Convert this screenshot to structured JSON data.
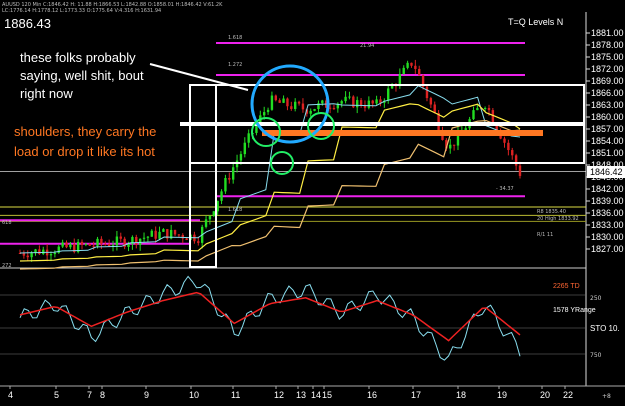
{
  "header": {
    "ticker_line": "AUUSD  120 Min  C:1846.42  H: 11.88  H:1866.53  L:1842.88  O:1858.01  H:1846.42  V:61.2K",
    "ticker_line2": "LC:1776.14  H:1778.12  L:1773.33  O:1775.64  V:4.316  H:1631.94",
    "last_price": "1886.43",
    "indicator_label": "T=Q Levels N"
  },
  "annotations": {
    "note1_line1": "these folks probably",
    "note1_line2": "saying, well shit, bout",
    "note1_line3": "right now",
    "note2_line1": "shoulders, they carry the",
    "note2_line2": "load or drop it like its hot"
  },
  "level_labels": {
    "fib_top": "1.618",
    "fib_mid": "1.272",
    "fib_low": "1.618",
    "peak_label": "21.94",
    "dip_label": "- 34.37",
    "r8": "R8  1835.40",
    "r20": "20 High  1833.92",
    "r1": "R/1 11",
    "left1": "618",
    "left2": "272"
  },
  "price_axis": {
    "ticks": [
      "1881.00",
      "1878.00",
      "1875.00",
      "1872.00",
      "1869.00",
      "1866.00",
      "1863.00",
      "1860.00",
      "1857.00",
      "1854.00",
      "1851.00",
      "1848.00",
      "1845.00",
      "1842.00",
      "1839.00",
      "1836.00",
      "1833.00",
      "1830.00",
      "1827.00"
    ],
    "current": "1846.42"
  },
  "sub_panel": {
    "td_label": "2265 TD",
    "yrange_label": "1578 YRange",
    "sto_label": "STO  10.",
    "axis_ticks": [
      "250",
      "",
      "750"
    ]
  },
  "x_axis": {
    "labels": [
      "4",
      "5",
      "7",
      "8",
      "9",
      "10",
      "11",
      "12",
      "13",
      "14",
      "15",
      "16",
      "17",
      "18",
      "19",
      "20",
      "22"
    ],
    "corner": "+8"
  },
  "colors": {
    "background": "#000000",
    "candle_up": "#22dd22",
    "candle_down": "#dd2222",
    "fib_magenta": "#ee22ee",
    "annotation_orange": "#ff7722",
    "circle_blue": "#22aaff",
    "circle_green": "#22ee66",
    "ma_yellow": "#ffee44",
    "ma_tan": "#f0c070",
    "ma_cyan": "#88ddee",
    "sto_red": "#ee2222"
  },
  "chart_data": {
    "type": "line",
    "title": "AUUSD 120 Min",
    "xlabel": "",
    "ylabel": "",
    "ylim": [
      1824,
      1884
    ],
    "x": [
      "4",
      "5",
      "7",
      "8",
      "9",
      "10",
      "11",
      "12",
      "13",
      "14",
      "15",
      "16",
      "17",
      "18",
      "19"
    ],
    "series": [
      {
        "values": [
          1826,
          1827,
          1828,
          1829,
          1831,
          1830,
          1848,
          1864,
          1862,
          1864,
          1863,
          1874,
          1852,
          1864,
          1846
        ]
      }
    ],
    "levels": [
      1878.5,
      1870.5,
      1840.2,
      1837.5,
      1835.4,
      1833.9,
      1828.3,
      1846.42
    ],
    "stochastic": [
      55,
      70,
      35,
      60,
      80,
      95,
      40,
      75,
      85,
      60,
      80,
      55,
      10,
      70,
      20
    ]
  }
}
